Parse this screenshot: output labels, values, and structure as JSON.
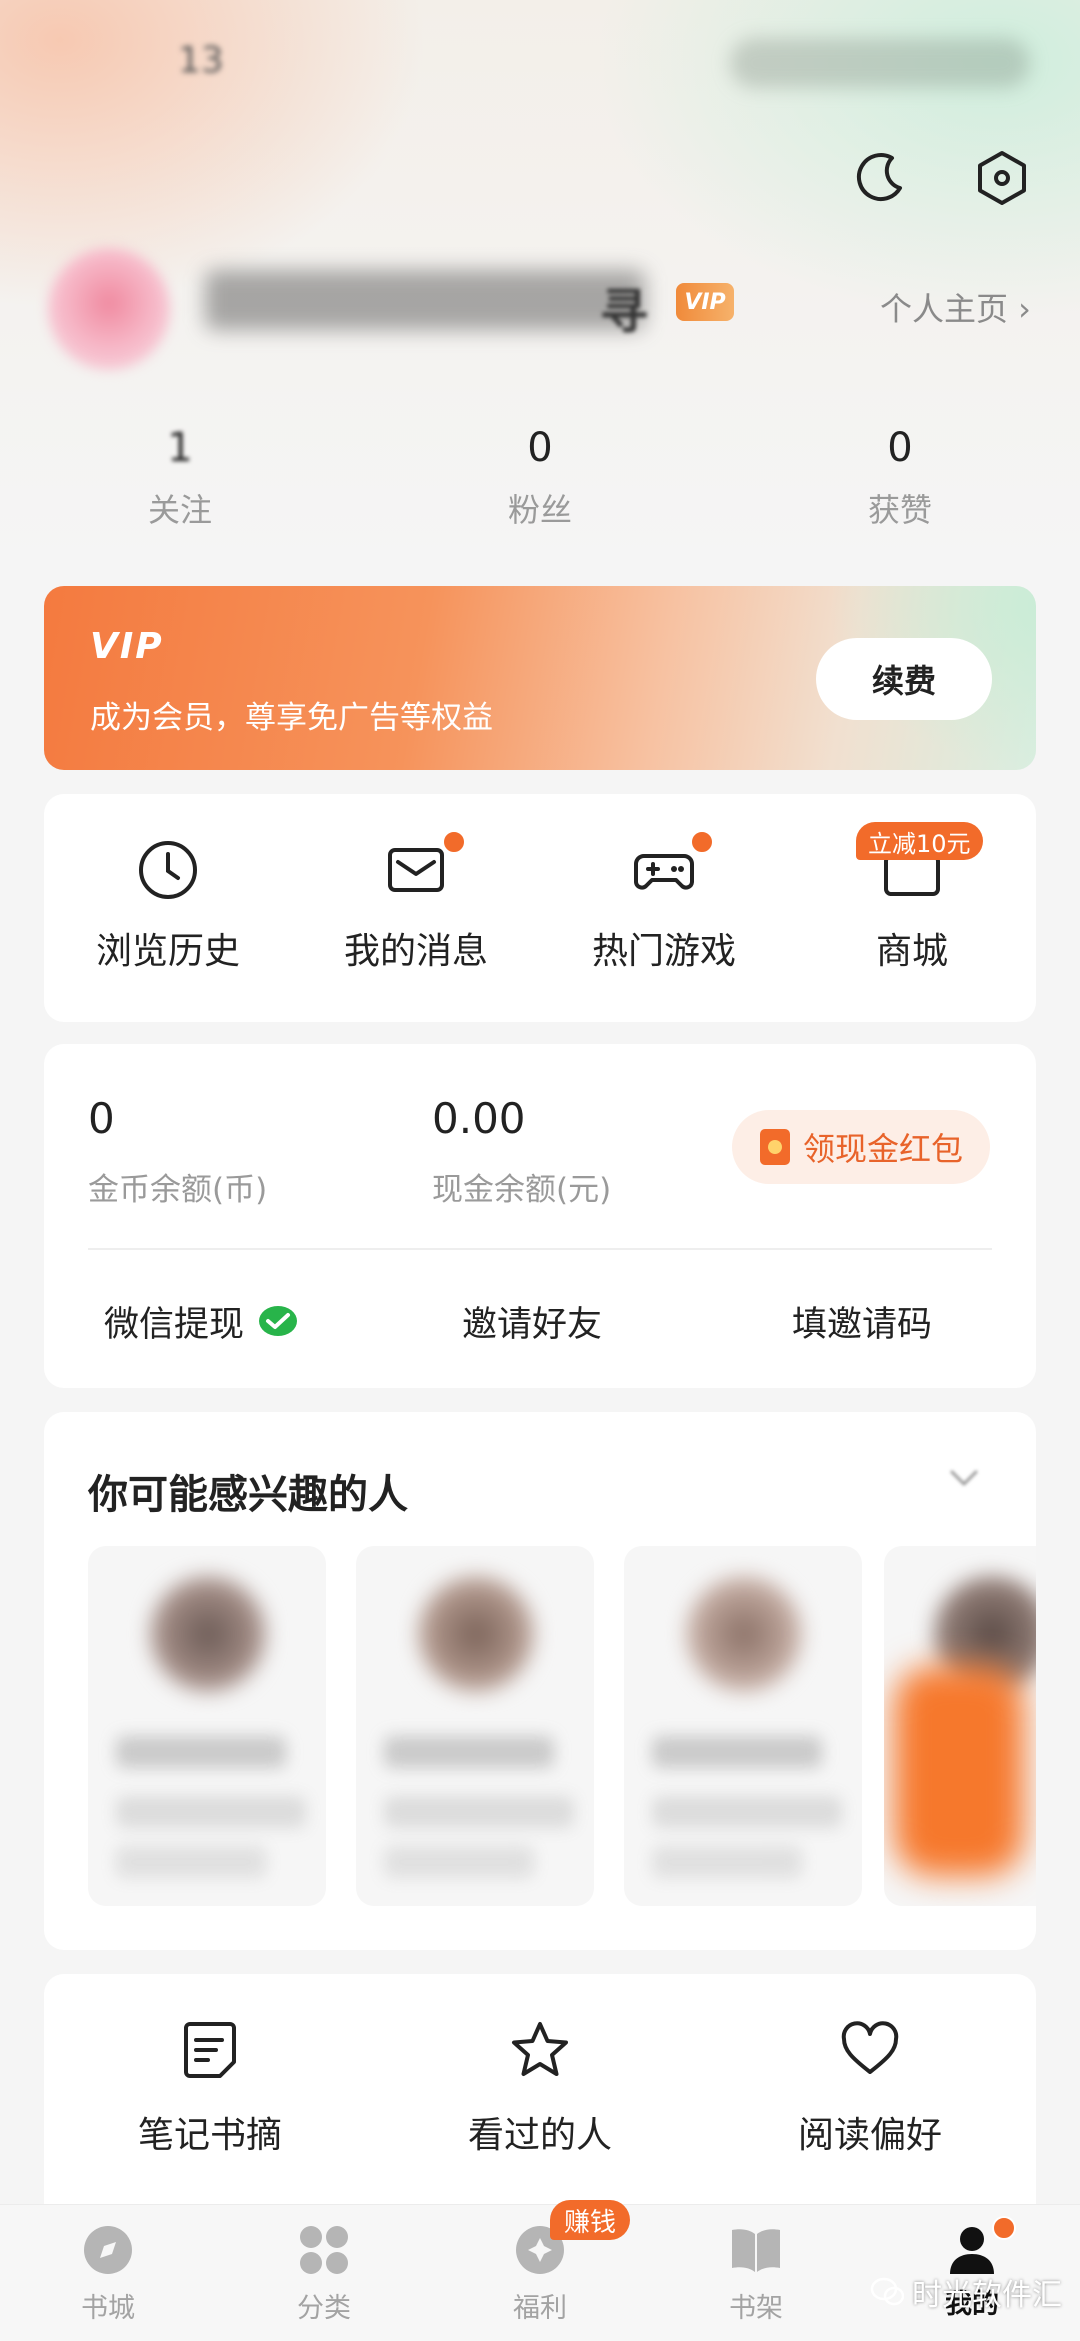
{
  "status_bar": {
    "time": "13"
  },
  "profile": {
    "name_tail": "寻",
    "vip_badge": "VIP",
    "profile_link": "个人主页 ›",
    "stats": [
      {
        "value": "1",
        "label": "关注"
      },
      {
        "value": "0",
        "label": "粉丝"
      },
      {
        "value": "0",
        "label": "获赞"
      }
    ]
  },
  "vip_banner": {
    "logo": "VIP",
    "description": "成为会员，尊享免广告等权益",
    "button": "续费"
  },
  "shortcuts": [
    {
      "label": "浏览历史",
      "icon": "clock-icon"
    },
    {
      "label": "我的消息",
      "icon": "mail-icon",
      "badge_dot": true
    },
    {
      "label": "热门游戏",
      "icon": "gamepad-icon",
      "badge_dot": true
    },
    {
      "label": "商城",
      "icon": "shop-icon",
      "tag": "立减10元"
    }
  ],
  "wallet": {
    "coin_value": "0",
    "coin_label": "金币余额(币)",
    "cash_value": "0.00",
    "cash_label": "现金余额(元)",
    "redpacket_button": "领现金红包",
    "actions": [
      "微信提现",
      "邀请好友",
      "填邀请码"
    ]
  },
  "suggested_people": {
    "title": "你可能感兴趣的人"
  },
  "tools": [
    {
      "label": "笔记书摘",
      "icon": "note-icon"
    },
    {
      "label": "看过的人",
      "icon": "star-icon"
    },
    {
      "label": "阅读偏好",
      "icon": "heart-icon"
    }
  ],
  "bottom_nav": {
    "items": [
      {
        "label": "书城",
        "icon": "compass-icon"
      },
      {
        "label": "分类",
        "icon": "grid-icon"
      },
      {
        "label": "福利",
        "icon": "gift-icon",
        "tag": "赚钱"
      },
      {
        "label": "书架",
        "icon": "book-icon"
      },
      {
        "label": "我的",
        "icon": "person-icon",
        "active": true
      }
    ]
  },
  "watermark": "时光软件汇",
  "colors": {
    "accent": "#f26b2a",
    "text": "#222222",
    "muted": "#9a9a9a"
  }
}
